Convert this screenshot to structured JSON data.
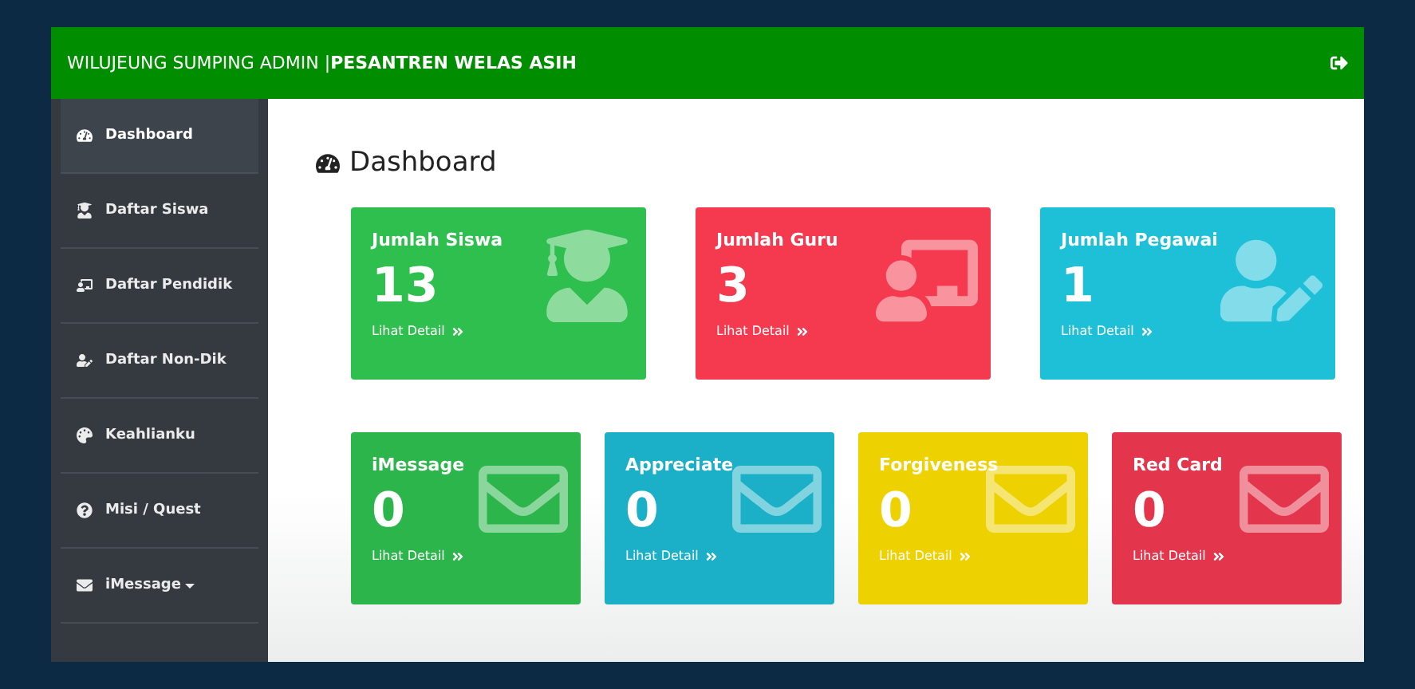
{
  "header": {
    "title": "WILUJEUNG SUMPING ADMIN | ",
    "subtitle": "PESANTREN WELAS ASIH"
  },
  "sidebar": {
    "items": [
      {
        "label": "Dashboard",
        "selected": true,
        "kind": "dashboard"
      },
      {
        "label": "Daftar Siswa",
        "selected": false,
        "kind": "student"
      },
      {
        "label": "Daftar Pendidik",
        "selected": false,
        "kind": "teacher"
      },
      {
        "label": "Daftar Non-Dik",
        "selected": false,
        "kind": "staff"
      },
      {
        "label": "Keahlianku",
        "selected": false,
        "kind": "skill"
      },
      {
        "label": "Misi / Quest",
        "selected": false,
        "kind": "quest"
      },
      {
        "label": "iMessage",
        "selected": false,
        "kind": "message",
        "dropdown": true
      }
    ]
  },
  "page": {
    "title": "Dashboard"
  },
  "stat_cards": [
    {
      "title": "Jumlah Siswa",
      "value": "13",
      "link": "Lihat Detail",
      "color": "#2fbf4f",
      "kind": "student"
    },
    {
      "title": "Jumlah Guru",
      "value": "3",
      "link": "Lihat Detail",
      "color": "#f53a4f",
      "kind": "teacher"
    },
    {
      "title": "Jumlah Pegawai",
      "value": "1",
      "link": "Lihat Detail",
      "color": "#1ec0d8",
      "kind": "staff"
    }
  ],
  "message_cards": [
    {
      "title": "iMessage",
      "value": "0",
      "link": "Lihat Detail",
      "color": "#2bb54a"
    },
    {
      "title": "Appreciate",
      "value": "0",
      "link": "Lihat Detail",
      "color": "#1cb0c8"
    },
    {
      "title": "Forgiveness",
      "value": "0",
      "link": "Lihat Detail",
      "color": "#eed100"
    },
    {
      "title": "Red Card",
      "value": "0",
      "link": "Lihat Detail",
      "color": "#e3354b"
    }
  ]
}
